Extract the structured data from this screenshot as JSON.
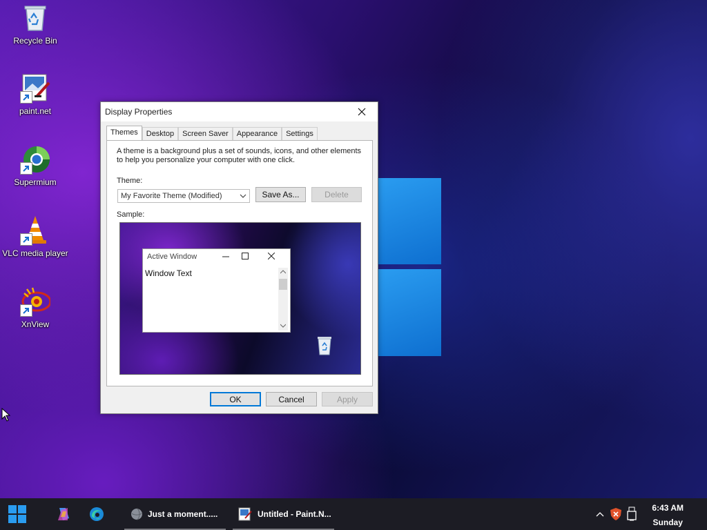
{
  "desktop": {
    "icons": [
      {
        "label": "Recycle Bin"
      },
      {
        "label": "paint.net"
      },
      {
        "label": "Supermium"
      },
      {
        "label": "VLC media player"
      },
      {
        "label": "XnView"
      }
    ]
  },
  "dialog": {
    "title": "Display Properties",
    "tabs": [
      "Themes",
      "Desktop",
      "Screen Saver",
      "Appearance",
      "Settings"
    ],
    "active_tab": "Themes",
    "description": "A theme is a background plus a set of sounds, icons, and other elements to help you personalize your computer with one click.",
    "theme_label": "Theme:",
    "theme_value": "My Favorite Theme (Modified)",
    "save_as_label": "Save As...",
    "delete_label": "Delete",
    "sample_label": "Sample:",
    "preview": {
      "window_title": "Active Window",
      "window_text": "Window Text"
    },
    "ok_label": "OK",
    "cancel_label": "Cancel",
    "apply_label": "Apply"
  },
  "taskbar": {
    "apps": [
      {
        "label": "Just a moment....."
      },
      {
        "label": "Untitled - Paint.N..."
      }
    ],
    "time": "6:43 AM",
    "day": "Sunday"
  },
  "colors": {
    "accent": "#0078d7",
    "windows_logo": "#1a86e0",
    "taskbar": "#1c1c24"
  }
}
